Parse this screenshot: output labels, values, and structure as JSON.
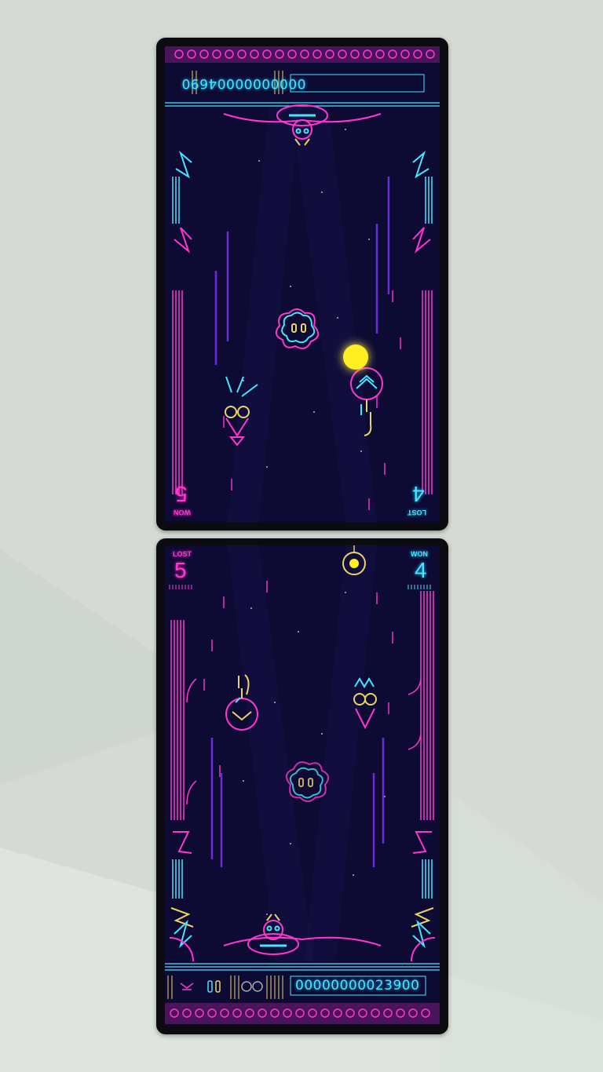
{
  "opponent_hud": {
    "score": "00000000004690",
    "won_label": "WON",
    "won_count": "5",
    "lost_label": "LOST",
    "lost_count": "4"
  },
  "player_hud": {
    "score": "00000000023900",
    "lost_label": "LOST",
    "lost_count": "5",
    "won_label": "WON",
    "won_count": "4"
  },
  "icons": {
    "paddle": "alien-paddle-icon",
    "bumpers": [
      "flower-face-icon",
      "skull-totem-icon",
      "masked-robot-icon",
      "glove-face-icon"
    ],
    "ball": "ball-icon"
  },
  "colors": {
    "background": "#0d0a33",
    "neon_pink": "#ff37cf",
    "neon_cyan": "#45e6ff",
    "neon_yellow": "#ffee22",
    "purple": "#6a2cd8"
  }
}
